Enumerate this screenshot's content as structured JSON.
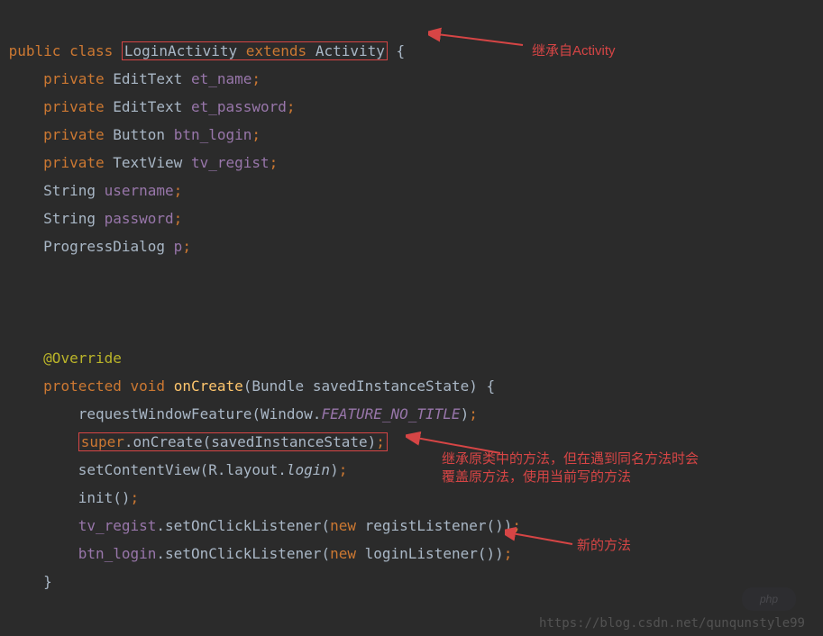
{
  "code": {
    "l1_public": "public",
    "l1_class": "class",
    "l1_box": "LoginActivity extends Activity",
    "l1_brace": " {",
    "l2_private": "private",
    "l2_type": "EditText",
    "l2_field": "et_name",
    "l3_private": "private",
    "l3_type": "EditText",
    "l3_field": "et_password",
    "l4_private": "private",
    "l4_type": "Button",
    "l4_field": "btn_login",
    "l5_private": "private",
    "l5_type": "TextView",
    "l5_field": "tv_regist",
    "l6_type": "String",
    "l6_field": "username",
    "l7_type": "String",
    "l7_field": "password",
    "l8_type": "ProgressDialog",
    "l8_field": "p",
    "l_override": "@Override",
    "lm_protected": "protected",
    "lm_void": "void",
    "lm_onCreate": "onCreate",
    "lm_param_type": "Bundle",
    "lm_param_name": "savedInstanceState",
    "lf_reqwf": "requestWindowFeature",
    "lf_window": "Window",
    "lf_const": "FEATURE_NO_TITLE",
    "lsuper_super": "super",
    "lsuper_call": ".onCreate(savedInstanceState)",
    "lsuper_semi": ";",
    "lscv_call": "setContentView",
    "lscv_R": "R",
    "lscv_layout": "layout",
    "lscv_login": "login",
    "linit": "init",
    "ltr_field": "tv_regist",
    "ltr_call": "setOnClickListener",
    "ltr_new": "new",
    "ltr_cls": "registListener",
    "lbl_field": "btn_login",
    "lbl_call": "setOnClickListener",
    "lbl_new": "new",
    "lbl_cls": "loginListener"
  },
  "annotations": {
    "a1": "继承自Activity",
    "a2_l1": "继承原类中的方法，但在遇到同名方法时会",
    "a2_l2": "覆盖原方法，使用当前写的方法",
    "a3": "新的方法"
  },
  "watermark": "https://blog.csdn.net/qunqunstyle99"
}
